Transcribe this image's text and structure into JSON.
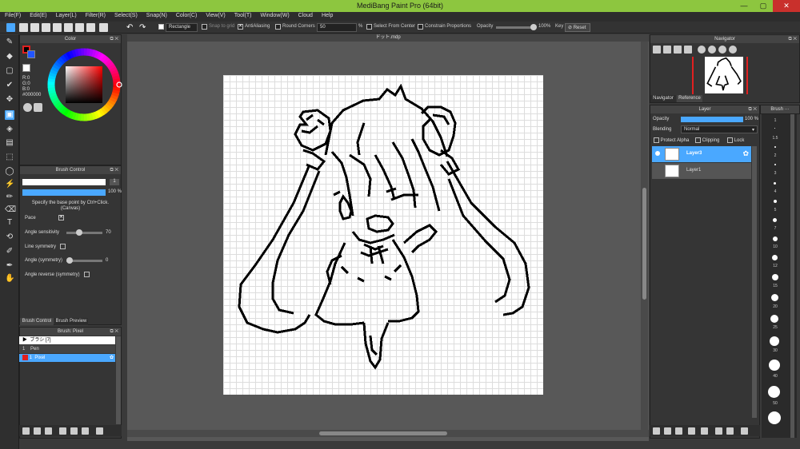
{
  "window": {
    "title": "MediBang Paint Pro (64bit)"
  },
  "menu": [
    "File(F)",
    "Edit(E)",
    "Layer(L)",
    "Filter(R)",
    "Select(S)",
    "Snap(N)",
    "Color(C)",
    "View(V)",
    "Tool(T)",
    "Window(W)",
    "Cloud",
    "Help"
  ],
  "toolbar": {
    "shape_select": "Rectangle",
    "snap_to_grid": "Snap to grid",
    "antialiasing": "AntiAliasing",
    "round_corners": "Round Corners",
    "round_corners_value": "50",
    "percent": "%",
    "select_from_center": "Select From Center",
    "constrain_proportions": "Constrain Proportions",
    "opacity_label": "Opacity",
    "opacity_value": "100%",
    "key_label": "Key",
    "reset_label": "Reset"
  },
  "color_panel": {
    "title": "Color",
    "r": "R:0",
    "g": "G:0",
    "b": "B:0",
    "hex": "#000000",
    "hue_ring_colors": [
      "#ff0000",
      "#ffff00",
      "#00ff00",
      "#00ffff",
      "#0000ff",
      "#ff00ff"
    ],
    "current_color": "#e02020"
  },
  "brush_control": {
    "title": "Brush Control",
    "size_value": "1",
    "opacity_value": "100 %",
    "hint": "Specify the base point by Ctrl+Click. (Canvas)",
    "pace_label": "Pace",
    "angle_sensitivity_label": "Angle sensitivity",
    "angle_sensitivity_value": "70",
    "line_symmetry_label": "Line symmetry",
    "angle_symmetry_label": "Angle (symmetry)",
    "angle_symmetry_value": "0",
    "angle_reverse_label": "Angle reverse (symmetry)",
    "tab1": "Brush Control",
    "tab2": "Brush Preview"
  },
  "brush_list": {
    "title": "Brush: Pixel",
    "group": "ブラシ [7]",
    "items": [
      {
        "num": "1",
        "name": "Pen"
      },
      {
        "num": "1",
        "name": "Pixel"
      }
    ]
  },
  "document": {
    "tab": "ドット.mdp"
  },
  "navigator": {
    "title": "Navigator",
    "tab1": "Navigator",
    "tab2": "Reference"
  },
  "layer_panel": {
    "title": "Layer",
    "opacity_label": "Opacity",
    "opacity_value": "100 %",
    "opacity_fraction": 1.0,
    "blending_label": "Blending",
    "blending_value": "Normal",
    "protect_alpha": "Protect Alpha",
    "clipping": "Clipping",
    "lock": "Lock",
    "layers": [
      {
        "name": "Layer3"
      },
      {
        "name": "Layer1"
      }
    ]
  },
  "brush_size_panel": {
    "title": "Brush ···",
    "sizes": [
      "1",
      "1.5",
      "2",
      "3",
      "4",
      "5",
      "7",
      "10",
      "12",
      "15",
      "20",
      "25",
      "30",
      "40",
      "50"
    ]
  }
}
